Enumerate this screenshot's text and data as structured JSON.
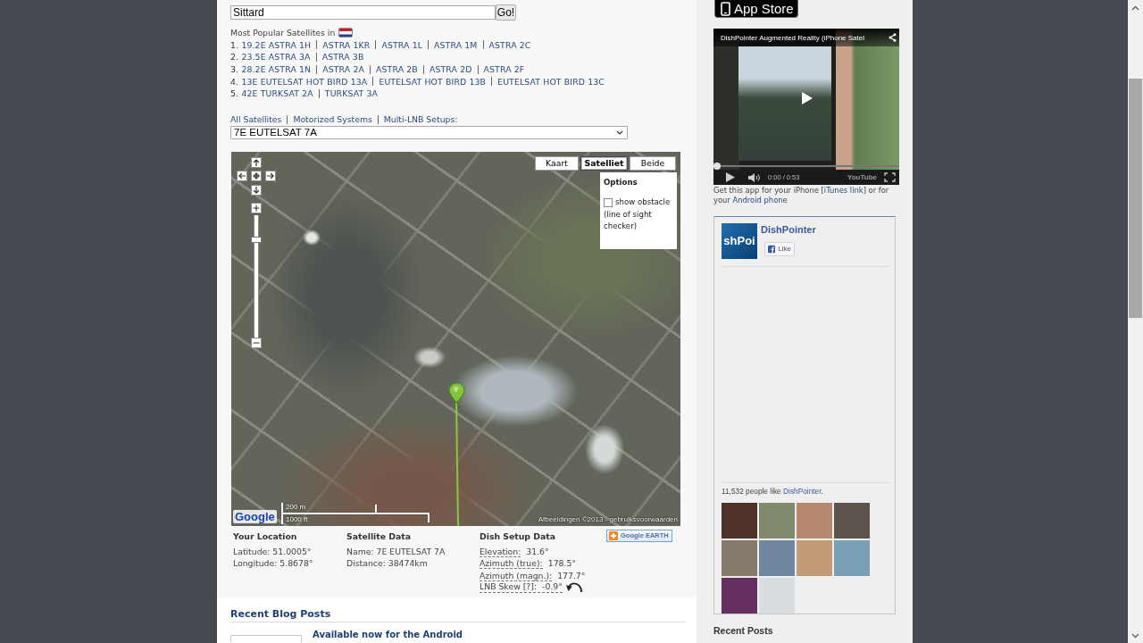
{
  "search": {
    "value": "Sittard",
    "button": "Go!"
  },
  "popular": {
    "heading": "Most Popular Satellites in",
    "lines": [
      {
        "number": "1.",
        "links": [
          "19.2E ASTRA 1H",
          "ASTRA 1KR",
          "ASTRA 1L",
          "ASTRA 1M",
          "ASTRA 2C"
        ]
      },
      {
        "number": "2.",
        "links": [
          "23.5E ASTRA 3A",
          "ASTRA 3B"
        ]
      },
      {
        "number": "3.",
        "links": [
          "28.2E ASTRA 1N",
          "ASTRA 2A",
          "ASTRA 2B",
          "ASTRA 2D",
          "ASTRA 2F"
        ]
      },
      {
        "number": "4.",
        "links": [
          "13E EUTELSAT HOT BIRD 13A",
          "EUTELSAT HOT BIRD 13B",
          "EUTELSAT HOT BIRD 13C"
        ]
      },
      {
        "number": "5.",
        "links": [
          "42E TURKSAT 2A",
          "TURKSAT 3A"
        ]
      }
    ]
  },
  "nav": {
    "links": [
      "All Satellites",
      "Motorized Systems",
      "Multi-LNB Setups:"
    ]
  },
  "satellite_select": {
    "value": "7E EUTELSAT 7A"
  },
  "map": {
    "zoom": {
      "level": 0.81
    },
    "types": [
      {
        "label": "Kaart",
        "selected": false
      },
      {
        "label": "Satelliet",
        "selected": true
      },
      {
        "label": "Beide",
        "selected": false
      }
    ],
    "options": {
      "title": "Options",
      "label": "show obstacle",
      "note": "(line of sight checker)",
      "checked": false
    },
    "scale": {
      "metric": "200 m",
      "imperial": "1000 ft"
    },
    "logo": "Google",
    "attribution": "Afbeeldingen ©2013 - gebruiksvoorwaarden"
  },
  "location": {
    "title": "Your Location",
    "rows": [
      "Latitude: 51.0005°",
      "Longitude: 5.8678°"
    ]
  },
  "satellite": {
    "title": "Satellite Data",
    "rows": [
      "Name: 7E EUTELSAT 7A",
      "Distance: 38474km"
    ]
  },
  "dish": {
    "title": "Dish Setup Data",
    "rows": [
      {
        "kind": "angle",
        "label": "Elevation:",
        "value": "31.6°"
      },
      {
        "kind": "angle",
        "label": "Azimuth (true):",
        "value": "178.5°"
      },
      {
        "kind": "angle",
        "label": "Azimuth (magn.):",
        "value": "177.7°"
      },
      {
        "kind": "skew",
        "label": "LNB Skew [?]:",
        "value": "-0.9°"
      }
    ]
  },
  "google_earth": {
    "label": "Google EARTH"
  },
  "blog": {
    "title": "Recent Blog Posts",
    "posts": [
      {
        "title": "Available now for the Android"
      }
    ]
  },
  "app_store": {
    "label": "App Store"
  },
  "video": {
    "title": "DishPointer Augmented Reality (iPhone Satel",
    "progress": {
      "level": 0
    },
    "time": "0:00 / 0:53",
    "logo": "YouTube"
  },
  "app_note": {
    "parts": [
      {
        "kind": "text",
        "text": "Get this app for your iPhone ["
      },
      {
        "kind": "link",
        "text": "iTunes link"
      },
      {
        "kind": "text",
        "text": "] or for your "
      },
      {
        "kind": "link",
        "text": "Android phone"
      }
    ]
  },
  "fan_box": {
    "logo_text": "shPoi",
    "page_name": "DishPointer",
    "like": "Like",
    "fans": [
      {
        "kind": "text",
        "text": "11,532 people like "
      },
      {
        "kind": "link",
        "text": "DishPointer"
      },
      {
        "kind": "text",
        "text": "."
      }
    ]
  },
  "recent_posts": {
    "title": "Recent Posts"
  }
}
